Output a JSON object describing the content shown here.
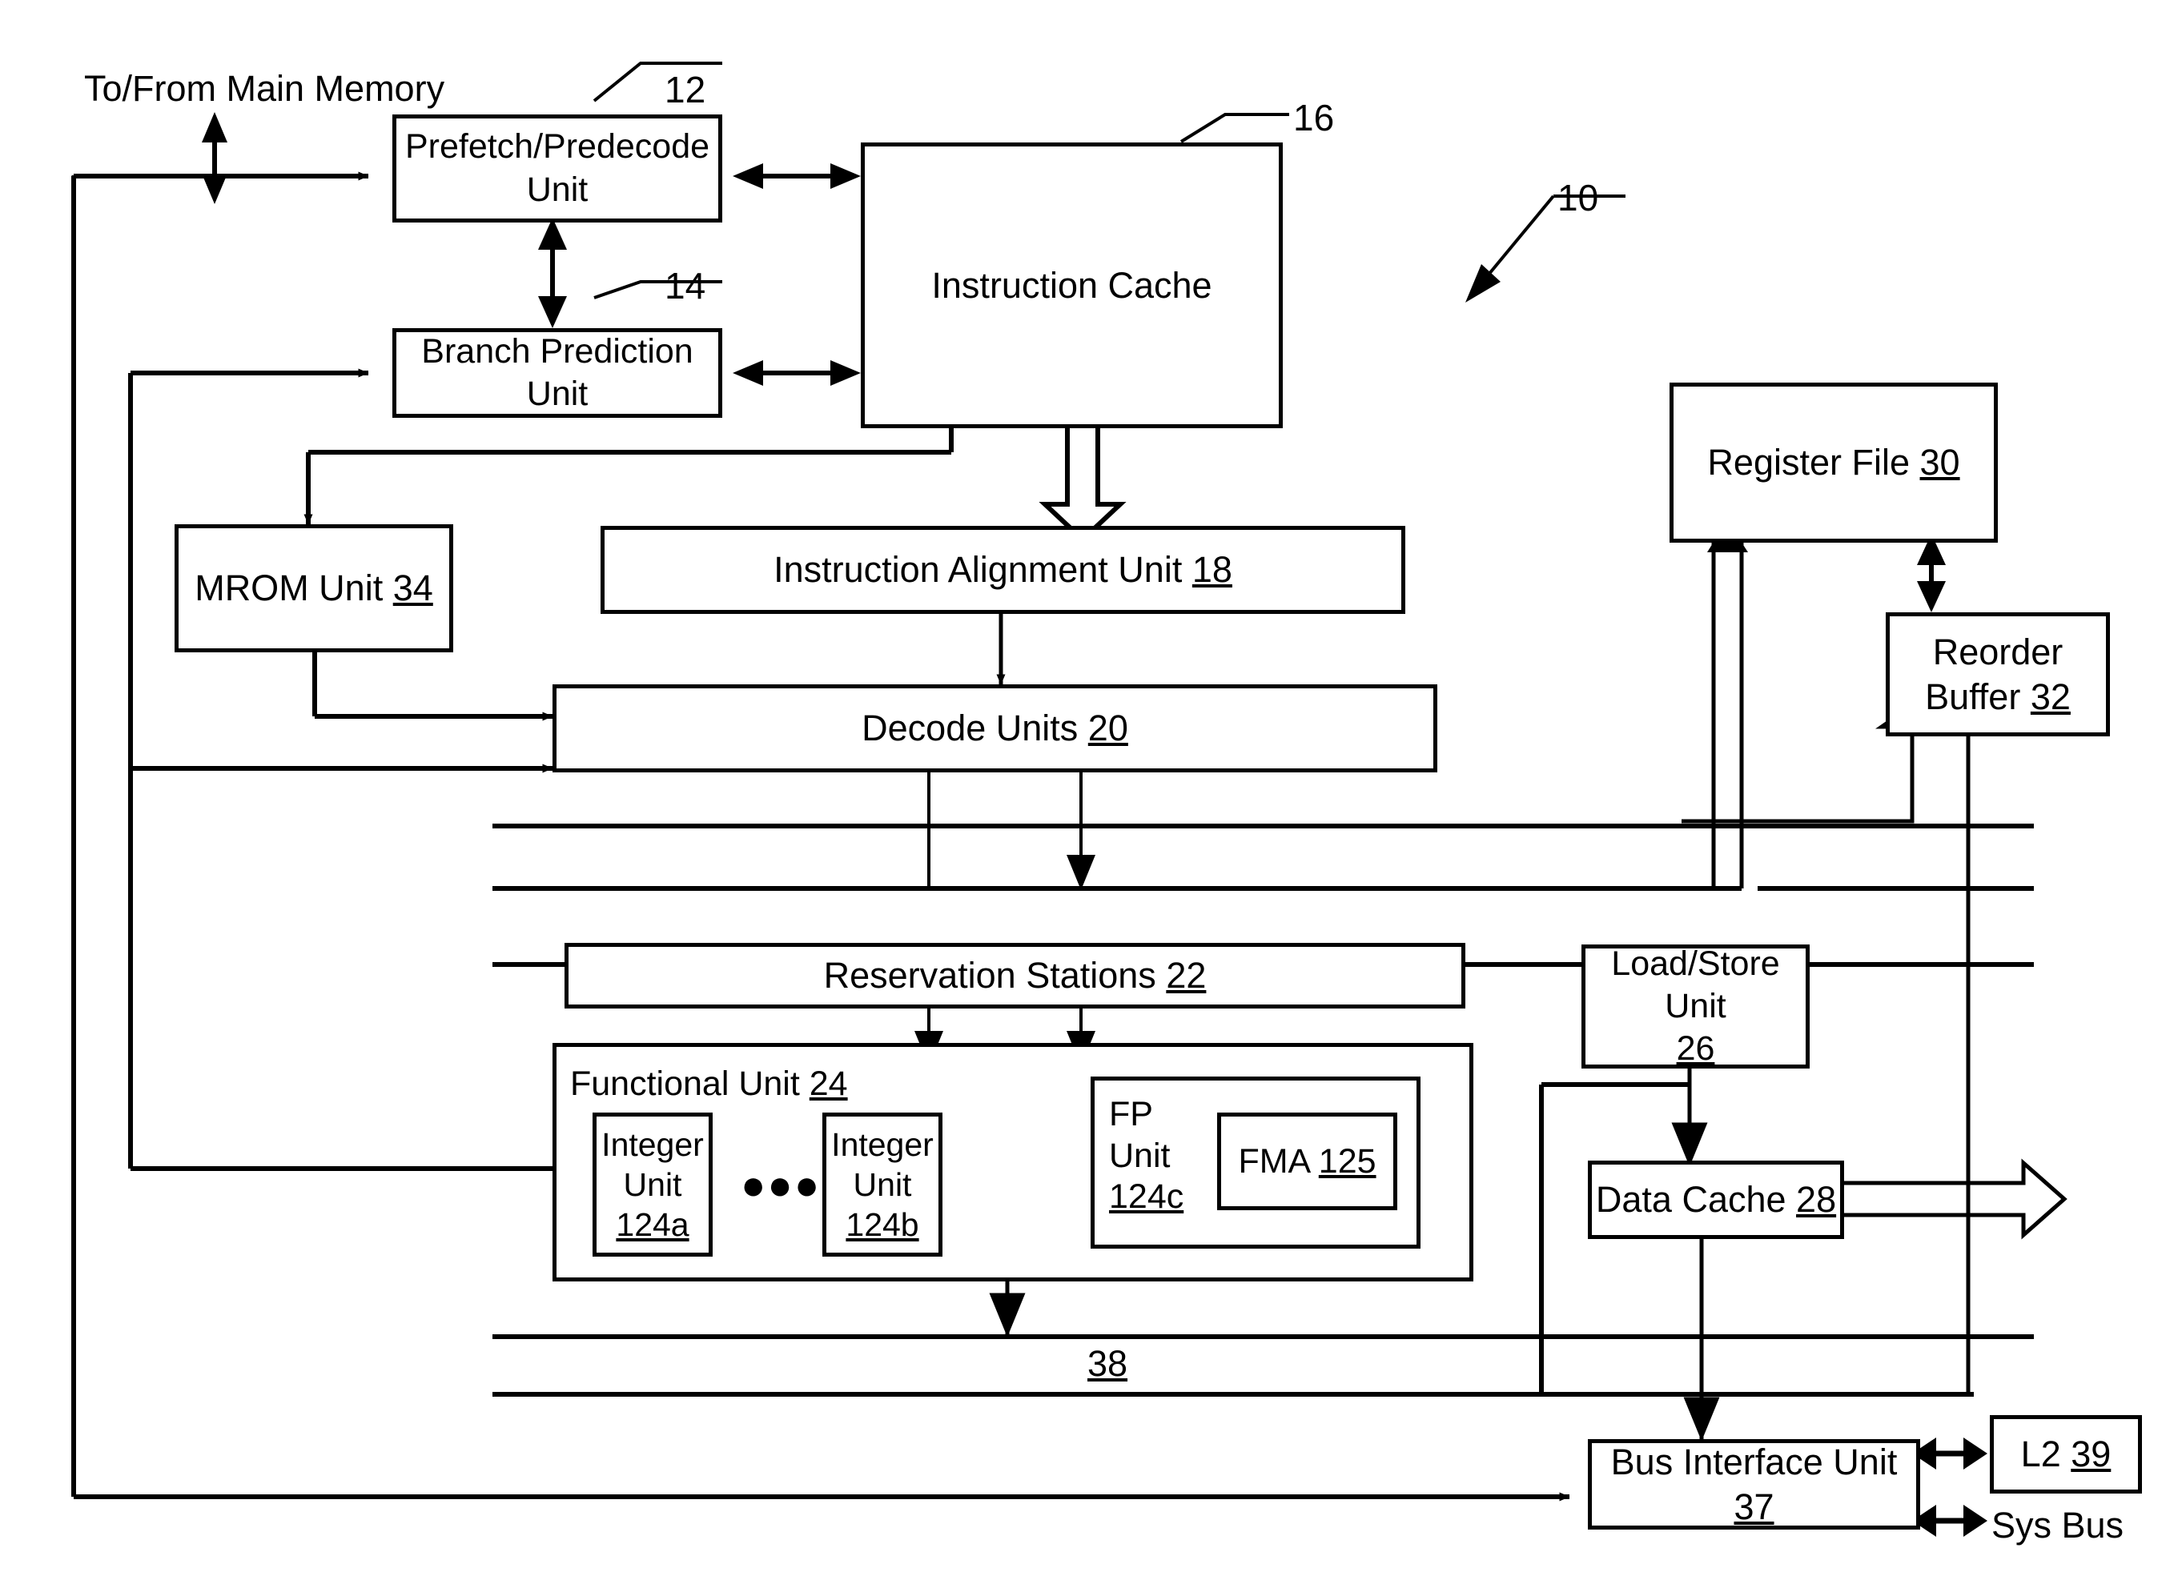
{
  "figure": {
    "title": "Microprocessor Block Diagram",
    "ref_main": "10",
    "external_label": "To/From Main Memory",
    "bus_label": "38",
    "sys_bus_label": "Sys Bus"
  },
  "blocks": [
    {
      "id": "prefetch",
      "name": "prefetch-predecode-unit",
      "lines": [
        "Prefetch/Predecode",
        "Unit"
      ],
      "ref": "12"
    },
    {
      "id": "branch",
      "name": "branch-prediction-unit",
      "lines": [
        "Branch Prediction Unit"
      ],
      "ref": "14"
    },
    {
      "id": "icache",
      "name": "instruction-cache",
      "lines": [
        "Instruction Cache"
      ],
      "ref": "16"
    },
    {
      "id": "mrom",
      "name": "mrom-unit",
      "label": "MROM Unit",
      "ref": "34"
    },
    {
      "id": "ialign",
      "name": "instruction-alignment-unit",
      "label": "Instruction Alignment Unit",
      "ref": "18"
    },
    {
      "id": "decode",
      "name": "decode-units",
      "label": "Decode Units",
      "ref": "20"
    },
    {
      "id": "regfile",
      "name": "register-file",
      "label": "Register File",
      "ref": "30"
    },
    {
      "id": "reorder",
      "name": "reorder-buffer",
      "lines": [
        "Reorder",
        "Buffer"
      ],
      "ref": "32"
    },
    {
      "id": "resstat",
      "name": "reservation-stations",
      "label": "Reservation Stations",
      "ref": "22"
    },
    {
      "id": "funcunit",
      "name": "functional-unit",
      "label": "Functional Unit",
      "ref": "24"
    },
    {
      "id": "intunit_a",
      "name": "integer-unit-124a",
      "lines": [
        "Integer",
        "Unit"
      ],
      "ref": "124a"
    },
    {
      "id": "intunit_b",
      "name": "integer-unit-124b",
      "lines": [
        "Integer",
        "Unit"
      ],
      "ref": "124b"
    },
    {
      "id": "fpunit",
      "name": "fp-unit",
      "lines": [
        "FP",
        "Unit"
      ],
      "ref": "124c"
    },
    {
      "id": "fma",
      "name": "fma-unit",
      "label": "FMA",
      "ref": "125"
    },
    {
      "id": "lsunit",
      "name": "load-store-unit",
      "lines": [
        "Load/Store",
        "Unit"
      ],
      "ref": "26"
    },
    {
      "id": "dcache",
      "name": "data-cache",
      "label": "Data Cache",
      "ref": "28"
    },
    {
      "id": "biu",
      "name": "bus-interface-unit",
      "label": "Bus Interface Unit",
      "ref": "37"
    },
    {
      "id": "l2",
      "name": "l2-cache",
      "label": "L2",
      "ref": "39"
    }
  ],
  "text": {
    "prefetch_l1": "Prefetch/Predecode",
    "prefetch_l2": "Unit",
    "prefetch_ref": "12",
    "branch_label": "Branch Prediction Unit",
    "branch_ref": "14",
    "icache_label": "Instruction Cache",
    "icache_ref": "16",
    "main_ref": "10",
    "mem_label": "To/From Main Memory",
    "mrom_label": "MROM Unit",
    "mrom_ref": "34",
    "ialign_label": "Instruction Alignment Unit",
    "ialign_ref": "18",
    "decode_label": "Decode Units",
    "decode_ref": "20",
    "regfile_label": "Register File",
    "regfile_ref": "30",
    "reorder_l1": "Reorder",
    "reorder_l2": "Buffer",
    "reorder_ref": "32",
    "resstat_label": "Reservation Stations",
    "resstat_ref": "22",
    "funcunit_label": "Functional Unit",
    "funcunit_ref": "24",
    "int_a_l1": "Integer",
    "int_a_l2": "Unit",
    "int_a_ref": "124a",
    "int_b_l1": "Integer",
    "int_b_l2": "Unit",
    "int_b_ref": "124b",
    "ellipsis": "●●●",
    "fp_l1": "FP",
    "fp_l2": "Unit",
    "fp_ref": "124c",
    "fma_label": "FMA",
    "fma_ref": "125",
    "ls_l1": "Load/Store",
    "ls_l2": "Unit",
    "ls_ref": "26",
    "dcache_label": "Data Cache",
    "dcache_ref": "28",
    "bus38_ref": "38",
    "biu_label": "Bus Interface Unit",
    "biu_ref": "37",
    "l2_label": "L2",
    "l2_ref": "39",
    "sysbus_label": "Sys Bus"
  },
  "colors": {
    "line": "#000000",
    "fill": "#ffffff",
    "text": "#000000"
  }
}
